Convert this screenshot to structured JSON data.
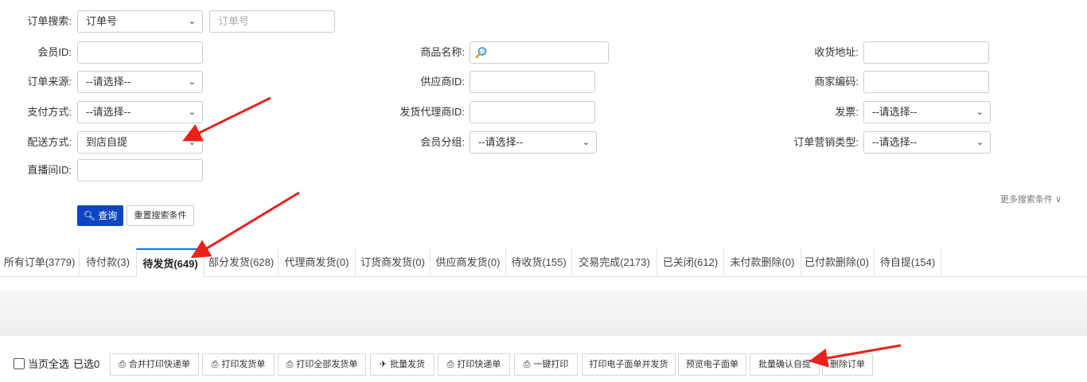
{
  "search": {
    "order_search_label": "订单搜索:",
    "order_search_type": "订单号",
    "order_search_placeholder": "订单号",
    "member_id_label": "会员ID:",
    "product_name_label": "商品名称:",
    "address_label": "收货地址:",
    "order_source_label": "订单来源:",
    "order_source_value": "--请选择--",
    "supplier_id_label": "供应商ID:",
    "merchant_code_label": "商家编码:",
    "payment_label": "支付方式:",
    "payment_value": "--请选择--",
    "agent_id_label": "发货代理商ID:",
    "invoice_label": "发票:",
    "invoice_value": "--请选择--",
    "delivery_label": "配送方式:",
    "delivery_value": "到店自提",
    "member_group_label": "会员分组:",
    "member_group_value": "--请选择--",
    "marketing_type_label": "订单营销类型:",
    "marketing_type_value": "--请选择--",
    "live_room_label": "直播间ID:",
    "query_button": "查询",
    "reset_button": "重置搜索条件",
    "more_conditions": "更多搜索条件"
  },
  "tabs": [
    {
      "label": "所有订单(3779)"
    },
    {
      "label": "待付款(3)"
    },
    {
      "label": "待发货(649)"
    },
    {
      "label": "部分发货(628)"
    },
    {
      "label": "代理商发货(0)"
    },
    {
      "label": "订货商发货(0)"
    },
    {
      "label": "供应商发货(0)"
    },
    {
      "label": "待收货(155)"
    },
    {
      "label": "交易完成(2173)"
    },
    {
      "label": "已关闭(612)"
    },
    {
      "label": "未付款删除(0)"
    },
    {
      "label": "已付款删除(0)"
    },
    {
      "label": "待自提(154)"
    }
  ],
  "active_tab": 2,
  "bulk": {
    "select_all_label": "当页全选",
    "selected_label": "已选0",
    "buttons": [
      {
        "label": "合并打印快递单",
        "icon": "printer-icon"
      },
      {
        "label": "打印发货单",
        "icon": "printer-icon"
      },
      {
        "label": "打印全部发货单",
        "icon": "printer-icon"
      },
      {
        "label": "批量发货",
        "icon": "plane-icon"
      },
      {
        "label": "打印快递单",
        "icon": "printer-icon"
      },
      {
        "label": "一键打印",
        "icon": "printer-icon"
      },
      {
        "label": "打印电子面单并发货",
        "icon": ""
      },
      {
        "label": "预览电子面单",
        "icon": ""
      },
      {
        "label": "批量确认自提",
        "icon": ""
      },
      {
        "label": "删除订单",
        "icon": ""
      }
    ]
  },
  "colors": {
    "primary": "#0c47c1",
    "annotation_arrow": "#e8231b",
    "active_tab_top": "#1a6dff"
  }
}
